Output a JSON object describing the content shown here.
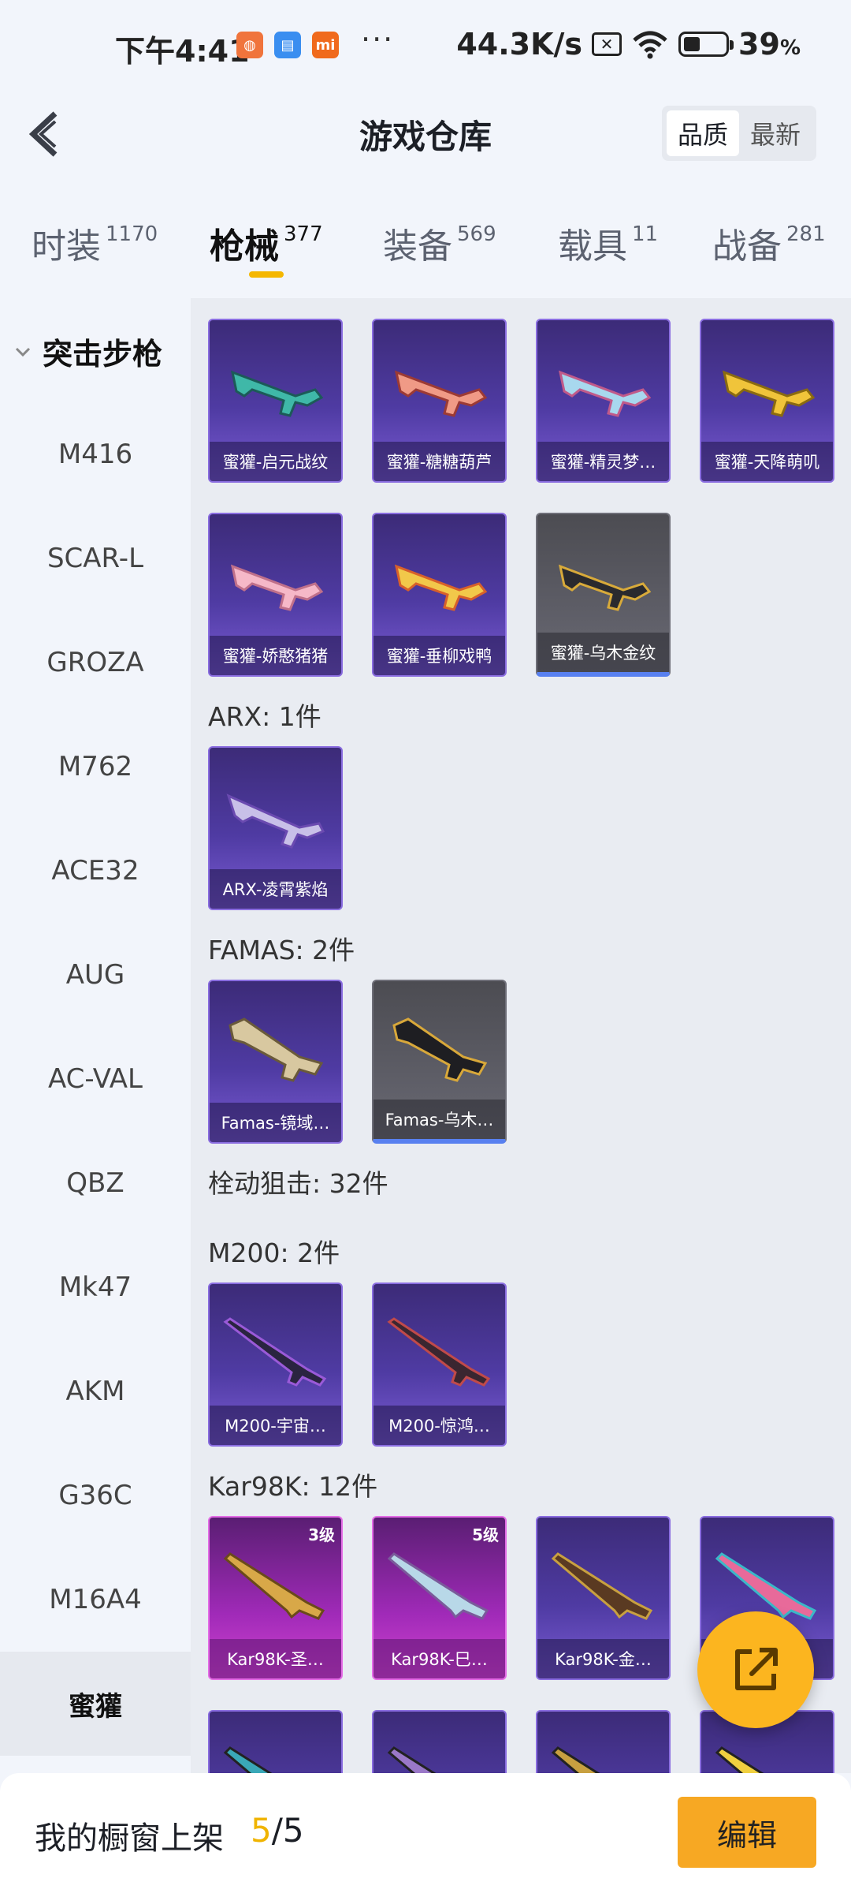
{
  "status": {
    "time": "下午4:41",
    "speed": "44.3K/s",
    "battery": "39",
    "battery_unit": "%",
    "dots": "···"
  },
  "header": {
    "title": "游戏仓库",
    "sort": [
      "品质",
      "最新"
    ]
  },
  "tabs": [
    {
      "label": "时装",
      "count": "1170"
    },
    {
      "label": "枪械",
      "count": "377"
    },
    {
      "label": "装备",
      "count": "569"
    },
    {
      "label": "载具",
      "count": "11"
    },
    {
      "label": "战备",
      "count": "281"
    }
  ],
  "sidebar": {
    "group": "突击步枪",
    "items": [
      "M416",
      "SCAR-L",
      "GROZA",
      "M762",
      "ACE32",
      "AUG",
      "AC-VAL",
      "QBZ",
      "Mk47",
      "AKM",
      "G36C",
      "M16A4",
      "蜜獾"
    ]
  },
  "sections": {
    "honey_badger_cards": [
      "蜜獾-启元战纹",
      "蜜獾-糖糖葫芦",
      "蜜獾-精灵梦…",
      "蜜獾-天降萌叽",
      "蜜獾-娇憨猪猪",
      "蜜獾-垂柳戏鸭",
      "蜜獾-乌木金纹"
    ],
    "arx_title": "ARX: 1件",
    "arx_cards": [
      "ARX-凌霄紫焰"
    ],
    "famas_title": "FAMAS: 2件",
    "famas_cards": [
      "Famas-镜域…",
      "Famas-乌木…"
    ],
    "bolt_title": "栓动狙击: 32件",
    "m200_title": "M200: 2件",
    "m200_cards": [
      "M200-宇宙…",
      "M200-惊鸿…"
    ],
    "kar_title": "Kar98K: 12件",
    "kar_cards": [
      "Kar98K-圣…",
      "Kar98K-巳…",
      "Kar98K-金…",
      ""
    ],
    "kar_levels": [
      "3级",
      "5级"
    ]
  },
  "bottom": {
    "label": "我的橱窗上架",
    "current": "5",
    "total": "/5",
    "edit": "编辑"
  },
  "colors": {
    "accent": "#f5b700",
    "purple_card": "#4f3ba3",
    "gray_card": "#5d5d66",
    "pink_card": "#a02ab8"
  }
}
